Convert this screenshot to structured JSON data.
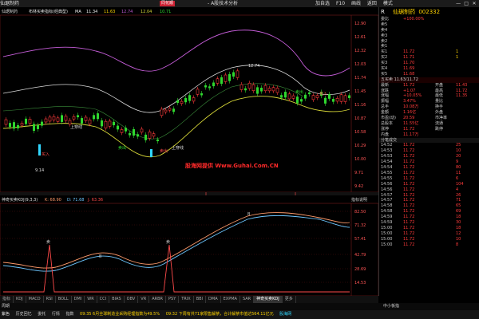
{
  "titlebar": {
    "left_text": "仙琚制药  ",
    "logo": "同花顺",
    "mid_text": "- A股技术分析",
    "menu": [
      "加自选",
      "F10",
      "画线",
      "返回",
      "模式"
    ],
    "win_controls": [
      "—",
      "□",
      "✕"
    ]
  },
  "main_header": {
    "items": [
      "仙琚制药",
      "布林买卖指标(经典型)",
      "MA",
      "11.34",
      "11.63",
      "12.74",
      "12.04",
      "10.71"
    ]
  },
  "kline": {
    "price_labels": [
      "12.90",
      "12.61",
      "12.32",
      "12.03",
      "11.74",
      "11.45",
      "11.16",
      "10.87",
      "10.58",
      "10.29",
      "10.00",
      "9.71",
      "9.42"
    ],
    "annotations": [
      "12.74",
      "上穿线",
      "上穿线",
      "9.14"
    ],
    "signal_labels": [
      "买入",
      "卖出",
      "卖出",
      "卖出",
      "买入"
    ],
    "watermark": "股海网提供 Www.Guhai.Com.CN"
  },
  "indicator": {
    "title": "神奇买卖KDJ(9,3,3)",
    "k_label": "K: 68.90",
    "d_label": "D: 71.68",
    "j_label": "J: 63.36",
    "right_tag": "指标说明",
    "level_labels": [
      "82.50",
      "71.32",
      "57.41",
      "42.79",
      "28.69",
      "14.53"
    ],
    "markers": [
      "卖",
      "卖",
      "B",
      "B"
    ]
  },
  "tabs": [
    "指标",
    "KDJ",
    "MACD",
    "RSI",
    "BOLL",
    "DMI",
    "WR",
    "CCI",
    "BIAS",
    "OBV",
    "VR",
    "ARBR",
    "PSY",
    "TRIX",
    "BBI",
    "DMA",
    "EXPMA",
    "SAR",
    "神奇买卖KDJ",
    "更多"
  ],
  "panel": {
    "code": "仙琚制药",
    "code_number": "002332",
    "rows": [
      [
        "委比",
        "+100.00%",
        "",
        ""
      ],
      [
        "卖5",
        "",
        "",
        ""
      ],
      [
        "卖4",
        "",
        "",
        ""
      ],
      [
        "卖3",
        "",
        "",
        ""
      ],
      [
        "卖2",
        "",
        "",
        ""
      ],
      [
        "卖1",
        "",
        "",
        ""
      ],
      [
        "买1",
        "11.72",
        "",
        "1"
      ],
      [
        "买2",
        "11.71",
        "",
        "1"
      ],
      [
        "买3",
        "11.70",
        "",
        ""
      ],
      [
        "买4",
        "11.69",
        "",
        ""
      ],
      [
        "买5",
        "11.68",
        "",
        ""
      ]
    ],
    "quote_title": "五买卖 11.63/11.72",
    "quote_rows": [
      [
        "最新",
        "11.72",
        "开盘",
        "11.43"
      ],
      [
        "涨跌",
        "+1.07",
        "最高",
        "11.72"
      ],
      [
        "涨幅",
        "+10.05%",
        "最低",
        "11.35"
      ],
      [
        "振幅",
        "3.47%",
        "量比",
        ""
      ],
      [
        "总手",
        "10.08万",
        "换手",
        ""
      ],
      [
        "金额",
        "1.16亿",
        "外盘",
        ""
      ],
      [
        "市盈(动)",
        "20.59",
        "市净率",
        ""
      ],
      [
        "总股本",
        "11.55亿",
        "流通",
        ""
      ],
      [
        "涨停",
        "11.72",
        "跌停",
        ""
      ],
      [
        "内盘",
        "11.17万",
        "",
        ""
      ]
    ],
    "ticks_title": "分笔成交",
    "ticks": [
      [
        "14:52",
        "11.72",
        "25"
      ],
      [
        "14:53",
        "11.72",
        "10"
      ],
      [
        "14:53",
        "11.72",
        "20"
      ],
      [
        "14:54",
        "11.72",
        "9"
      ],
      [
        "14:54",
        "11.72",
        "80"
      ],
      [
        "14:55",
        "11.72",
        "11"
      ],
      [
        "14:55",
        "11.72",
        "6"
      ],
      [
        "14:56",
        "11.72",
        "104"
      ],
      [
        "14:56",
        "11.72",
        "4"
      ],
      [
        "14:57",
        "11.72",
        "26"
      ],
      [
        "14:57",
        "11.72",
        "71"
      ],
      [
        "14:58",
        "11.72",
        "65"
      ],
      [
        "14:58",
        "11.72",
        "69"
      ],
      [
        "14:59",
        "11.72",
        "18"
      ],
      [
        "14:59",
        "11.72",
        "30"
      ],
      [
        "15:00",
        "11.72",
        "18"
      ],
      [
        "15:00",
        "11.72",
        "12"
      ],
      [
        "15:00",
        "11.72",
        "10"
      ],
      [
        "15:00",
        "11.72",
        "8"
      ]
    ]
  },
  "midbar": {
    "left": "周期",
    "right": "中小板指"
  },
  "statusbar": {
    "items": [
      "紫色",
      "历史回忆",
      "委托",
      "行情",
      "指数",
      "09:35 6月全球制造业采购经理指数为49.5%",
      "09:32 下周有共71家限售解禁，合计解禁市值达564.11亿元",
      "股海网"
    ]
  },
  "colors": {
    "up": "#ff3b3b",
    "down": "#2fd72f",
    "boll_upper": "#c35cd6",
    "boll_mid": "#d9d9d9",
    "boll_lower": "#d6d637",
    "k_line": "#ff9a6a",
    "d_line": "#6cc6ff",
    "j_line": "#ff4a4a"
  }
}
